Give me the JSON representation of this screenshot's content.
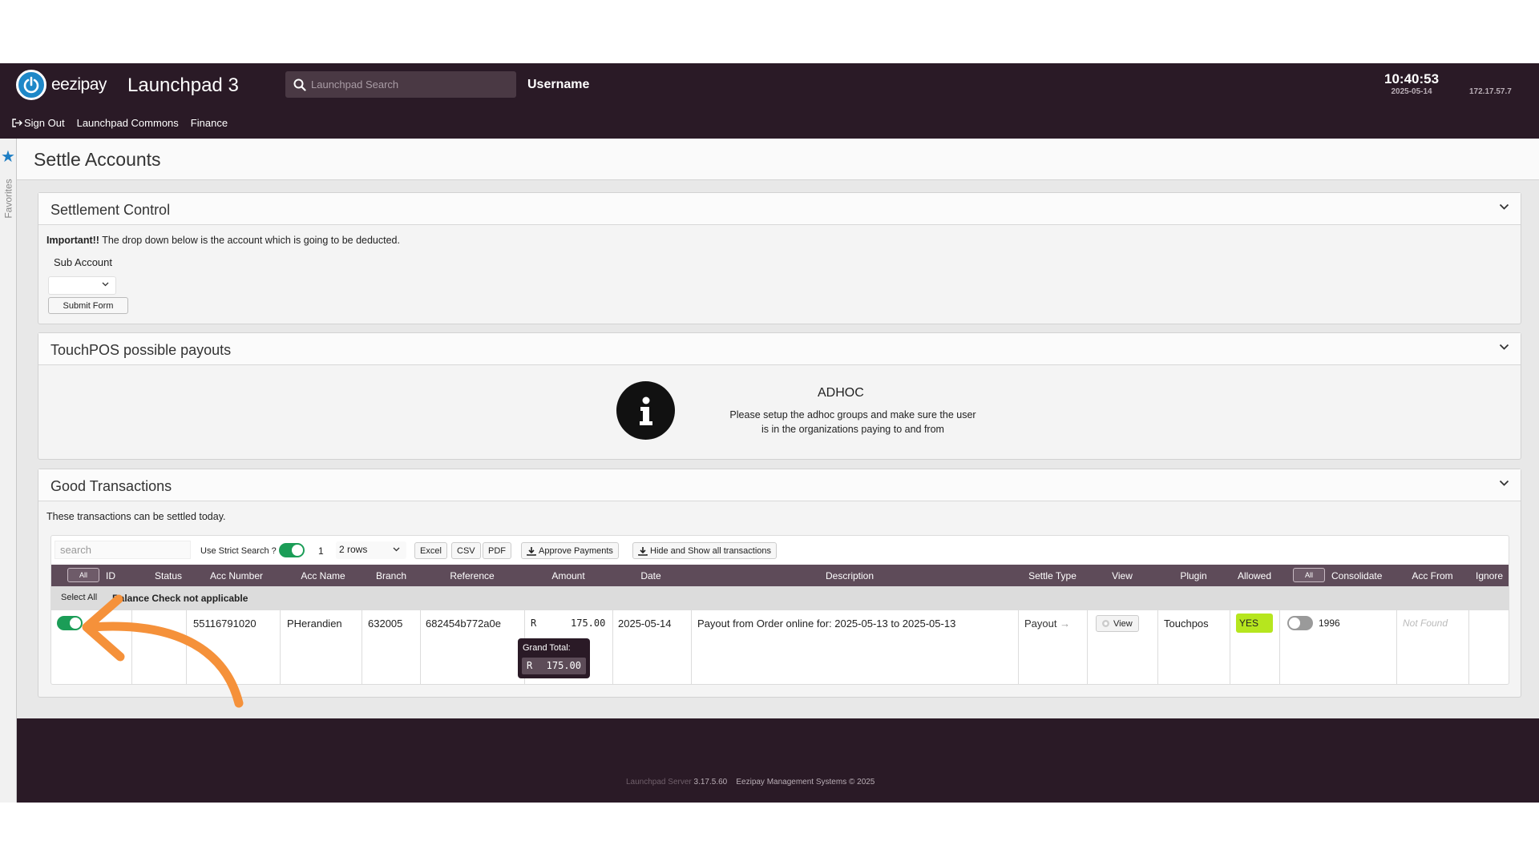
{
  "header": {
    "brand": "eezipay",
    "app_title": "Launchpad 3",
    "search_placeholder": "Launchpad Search",
    "username": "Username",
    "time": "10:40:53",
    "date": "2025-05-14",
    "ip": "172.17.57.7",
    "nav": [
      "Sign Out",
      "Launchpad Commons",
      "Finance"
    ]
  },
  "favorites_label": "Favorites",
  "page_title": "Settle Accounts",
  "settlement": {
    "title": "Settlement Control",
    "important_bold": "Important!!",
    "important_text": " The drop down below is the account which is going to be deducted.",
    "sub_account_label": "Sub Account",
    "sub_account_value": "",
    "submit_label": "Submit Form"
  },
  "touchpos": {
    "title": "TouchPOS possible payouts",
    "adhoc_title": "ADHOC",
    "adhoc_message": "Please setup the adhoc groups and make sure the user is in the organizations paying to and from"
  },
  "good": {
    "title": "Good Transactions",
    "note": "These transactions can be settled today.",
    "search_placeholder": "search",
    "strict_label": "Use Strict Search ?",
    "strict_on": true,
    "page": "1",
    "rows_option": "2 rows",
    "buttons": {
      "excel": "Excel",
      "csv": "CSV",
      "pdf": "PDF",
      "approve": "Approve Payments",
      "hide_show": "Hide and Show all transactions"
    },
    "all_pill": "All",
    "columns": [
      "ID",
      "Status",
      "Acc Number",
      "Acc Name",
      "Branch",
      "Reference",
      "Amount",
      "Date",
      "Description",
      "Settle Type",
      "View",
      "Plugin",
      "Allowed",
      "Consolidate",
      "Acc From",
      "Ignore"
    ],
    "select_all": "Select All",
    "group_label": "Balance Check not applicable",
    "row": {
      "selected": true,
      "acc_number": "55116791020",
      "acc_name": "PHerandien",
      "branch": "632005",
      "reference": "682454b772a0e",
      "currency": "R",
      "amount": "175.00",
      "date": "2025-05-14",
      "description": "Payout from Order online for: 2025-05-13 to 2025-05-13",
      "settle_type": "Payout",
      "view": "View",
      "plugin": "Touchpos",
      "allowed": "YES",
      "consolidate_on": false,
      "consolidate_value": "1996",
      "acc_from": "Not Found"
    },
    "grand_total_label": "Grand Total:",
    "grand_total_currency": "R",
    "grand_total_value": "175.00"
  },
  "footer": {
    "server": "Launchpad Server",
    "version": "3.17.5.60",
    "copyright": "Eezipay Management Systems © 2025"
  },
  "colors": {
    "header_bg": "#2a1a26",
    "table_head_bg": "#5e4b59",
    "toggle_on": "#1b9d57",
    "allowed_badge": "#b6e61e",
    "annotation_arrow": "#f5913a"
  }
}
